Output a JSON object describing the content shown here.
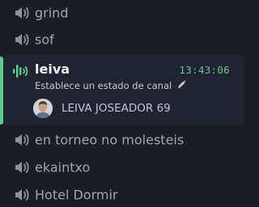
{
  "channels_above": [
    {
      "name": "grind",
      "icon": "voice-icon"
    },
    {
      "name": "sof",
      "icon": "voice-icon"
    }
  ],
  "active_channel": {
    "name": "leiva",
    "icon": "voice-active-icon",
    "timer": "13:43:06",
    "status_prompt": "Establece un estado de canal",
    "status_icon": "pencil-icon",
    "member": {
      "name": "LEIVA JOSEADOR 69",
      "avatar_icon": "avatar"
    },
    "accent": "#5dcc92"
  },
  "channels_below": [
    {
      "name": "en torneo no molesteis",
      "icon": "voice-icon"
    },
    {
      "name": "ekaintxo",
      "icon": "voice-icon"
    },
    {
      "name": "Hotel Dormir",
      "icon": "voice-icon"
    }
  ]
}
